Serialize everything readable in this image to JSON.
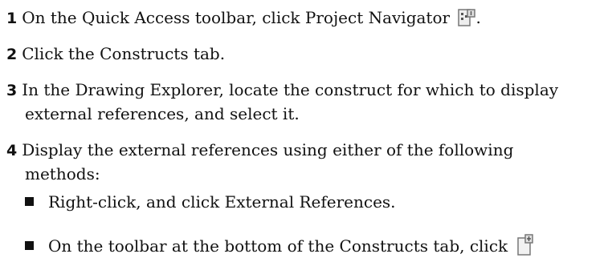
{
  "steps": [
    {
      "num": "1",
      "text": "On the Quick Access toolbar, click Project Navigator",
      "icon": "project-navigator-icon",
      "after": "."
    },
    {
      "num": "2",
      "text": "Click the Constructs tab."
    },
    {
      "num": "3",
      "line1": "In the Drawing Explorer, locate the construct for which to display",
      "line2": "external references, and select it."
    },
    {
      "num": "4",
      "line1": "Display the external references using either of the following",
      "line2": "methods:"
    }
  ],
  "bullets": [
    {
      "text": "Right-click, and click External References."
    },
    {
      "text": "On the toolbar at the bottom of the Constructs tab, click",
      "icon": "external-references-icon"
    }
  ]
}
